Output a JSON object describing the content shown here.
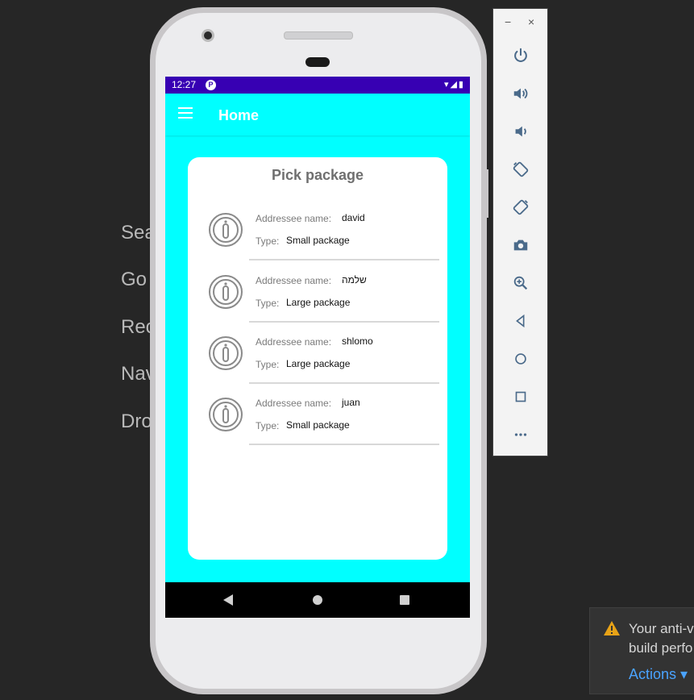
{
  "background_menu": [
    "Sea",
    "Go",
    "Rec",
    "Nav",
    "Dro"
  ],
  "status_bar": {
    "time": "12:27",
    "badge": "P",
    "icons": "▾◢▮"
  },
  "app_bar": {
    "title": "Home",
    "menu_icon": "hamburger-icon"
  },
  "card": {
    "title": "Pick package",
    "labels": {
      "addressee": "Addressee name:",
      "type": "Type:"
    },
    "items": [
      {
        "name": "david",
        "type": "Small package"
      },
      {
        "name": "שלמה",
        "type": "Large package"
      },
      {
        "name": "shlomo",
        "type": "Large package"
      },
      {
        "name": "juan",
        "type": "Small package"
      }
    ]
  },
  "emulator_toolbar": {
    "minimize": "−",
    "close": "×",
    "buttons": [
      "power-icon",
      "volume-up-icon",
      "volume-down-icon",
      "rotate-left-icon",
      "rotate-right-icon",
      "camera-icon",
      "zoom-icon",
      "back-icon",
      "home-icon",
      "overview-icon",
      "more-icon"
    ]
  },
  "notification": {
    "message_line1": "Your anti-v",
    "message_line2": "build perfo",
    "actions_label": "Actions ▾"
  },
  "colors": {
    "screen": "#00ffff",
    "status_bar": "#3700b3",
    "accent": "#4aa3ff"
  }
}
